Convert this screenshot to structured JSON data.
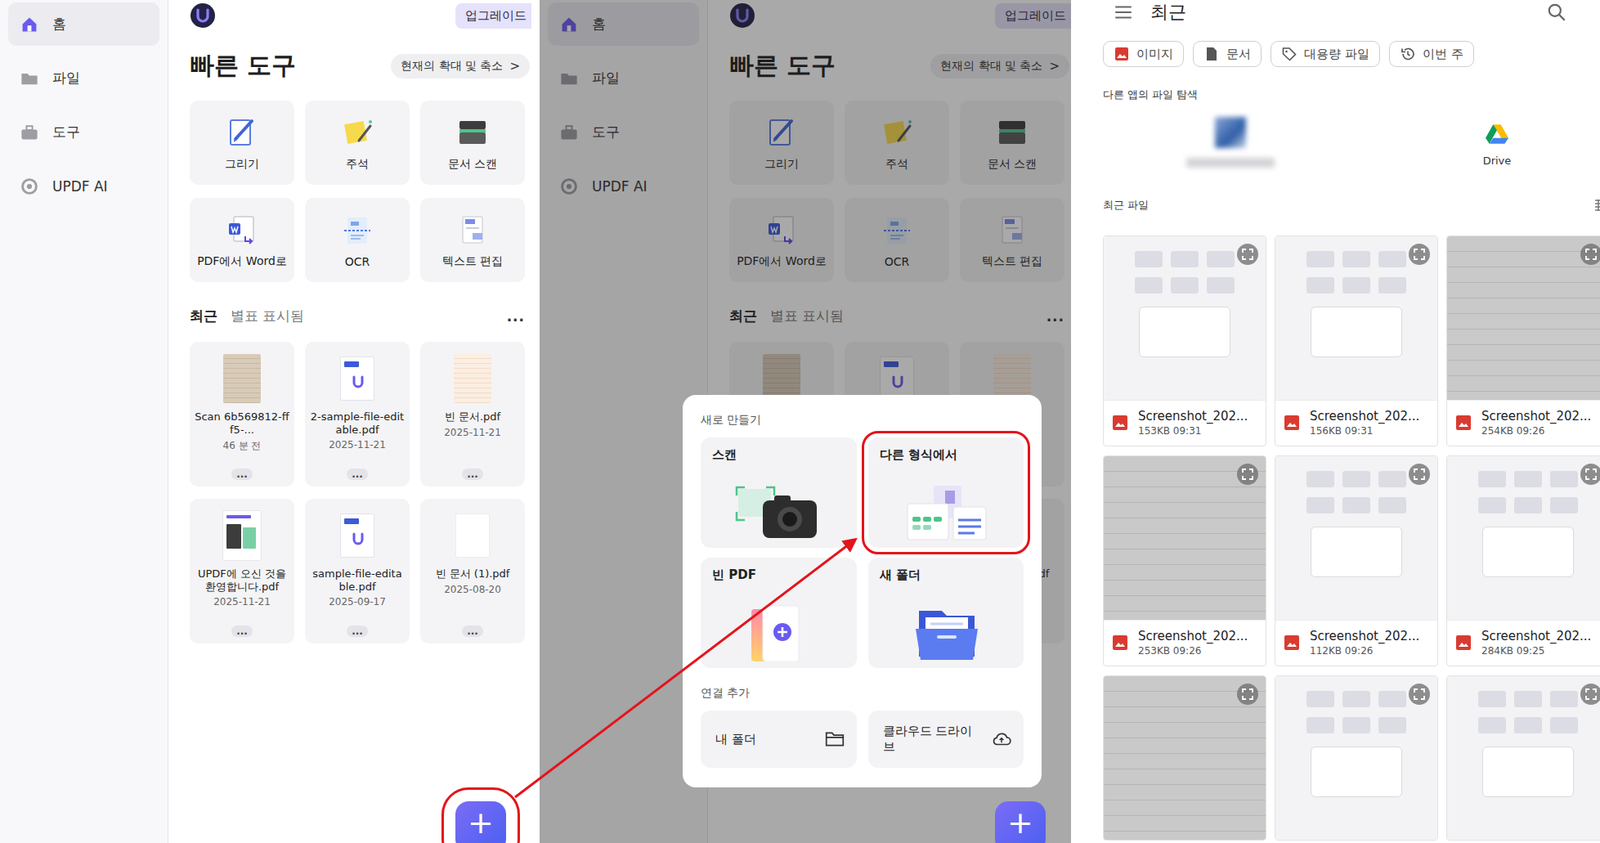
{
  "home": {
    "sidebar": [
      {
        "label": "홈",
        "selected": true
      },
      {
        "label": "파일",
        "selected": false
      },
      {
        "label": "도구",
        "selected": false
      },
      {
        "label": "UPDF AI",
        "selected": false
      }
    ],
    "upgrade_button": "업그레이드",
    "quick_tools": {
      "title": "빠른 도구",
      "zoom_button": "현재의 확대 및 축소",
      "chevron": ">",
      "items": [
        {
          "label": "그리기",
          "kind": "draw"
        },
        {
          "label": "주석",
          "kind": "annotate"
        },
        {
          "label": "문서 스캔",
          "kind": "scan"
        },
        {
          "label": "PDF에서 Word로",
          "kind": "word"
        },
        {
          "label": "OCR",
          "kind": "ocr"
        },
        {
          "label": "텍스트 편집",
          "kind": "textedit"
        }
      ]
    },
    "file_tabs": [
      {
        "label": "최근",
        "selected": true
      },
      {
        "label": "별표 표시됨",
        "selected": false
      }
    ],
    "more": "...",
    "files": [
      {
        "name": "Scan 6b569812-fff5-...",
        "meta": "46 분 전",
        "kind": "scan"
      },
      {
        "name": "2-sample-file-editable.pdf",
        "meta": "2025-11-21",
        "kind": "pdf"
      },
      {
        "name": "빈 문서.pdf",
        "meta": "2025-11-21",
        "kind": "lined"
      },
      {
        "name": "UPDF에 오신 것을 환영합니다.pdf",
        "meta": "2025-11-21",
        "kind": "guide"
      },
      {
        "name": "sample-file-editable.pdf",
        "meta": "2025-09-17",
        "kind": "pdf"
      },
      {
        "name": "빈 문서 (1).pdf",
        "meta": "2025-08-20",
        "kind": "blank"
      }
    ],
    "file_more": "...",
    "fab": "+"
  },
  "panels": [
    {
      "overlay": false,
      "highlight_fab": true
    },
    {
      "overlay": true,
      "highlight_fab": false
    }
  ],
  "create_sheet": {
    "title": "새로 만들기",
    "options": [
      {
        "label": "스캔",
        "kind": "scan",
        "highlighted": false
      },
      {
        "label": "다른 형식에서",
        "kind": "convert",
        "highlighted": true
      },
      {
        "label": "빈 PDF",
        "kind": "blank",
        "highlighted": false
      },
      {
        "label": "새 폴더",
        "kind": "folder",
        "highlighted": false
      }
    ],
    "connect_title": "연결 추가",
    "connections": [
      {
        "label": "내 폴더",
        "kind": "folder"
      },
      {
        "label": "클라우드 드라이브",
        "kind": "cloud"
      }
    ]
  },
  "picker": {
    "title": "최근",
    "chips": [
      {
        "label": "이미지",
        "kind": "image"
      },
      {
        "label": "문서",
        "kind": "doc"
      },
      {
        "label": "대용량 파일",
        "kind": "tag"
      },
      {
        "label": "이번 주",
        "kind": "history"
      }
    ],
    "other_apps_title": "다른 앱의 파일 탐색",
    "apps": [
      {
        "label": "",
        "blurred": true
      },
      {
        "label": "Drive",
        "blurred": false
      }
    ],
    "recent_title": "최근 파일",
    "files": [
      {
        "name": "Screenshot_202...",
        "meta": "153KB 09:31",
        "kind": "screenshot"
      },
      {
        "name": "Screenshot_202...",
        "meta": "156KB 09:31",
        "kind": "screenshot"
      },
      {
        "name": "Screenshot_202...",
        "meta": "254KB 09:26",
        "kind": "photo"
      },
      {
        "name": "Screenshot_202...",
        "meta": "253KB 09:26",
        "kind": "photo"
      },
      {
        "name": "Screenshot_202...",
        "meta": "112KB 09:26",
        "kind": "screenshot"
      },
      {
        "name": "Screenshot_202...",
        "meta": "284KB 09:25",
        "kind": "screenshot"
      },
      {
        "name": "",
        "meta": "",
        "kind": "photo"
      },
      {
        "name": "",
        "meta": "",
        "kind": "screenshot"
      },
      {
        "name": "",
        "meta": "",
        "kind": "screenshot"
      }
    ]
  }
}
